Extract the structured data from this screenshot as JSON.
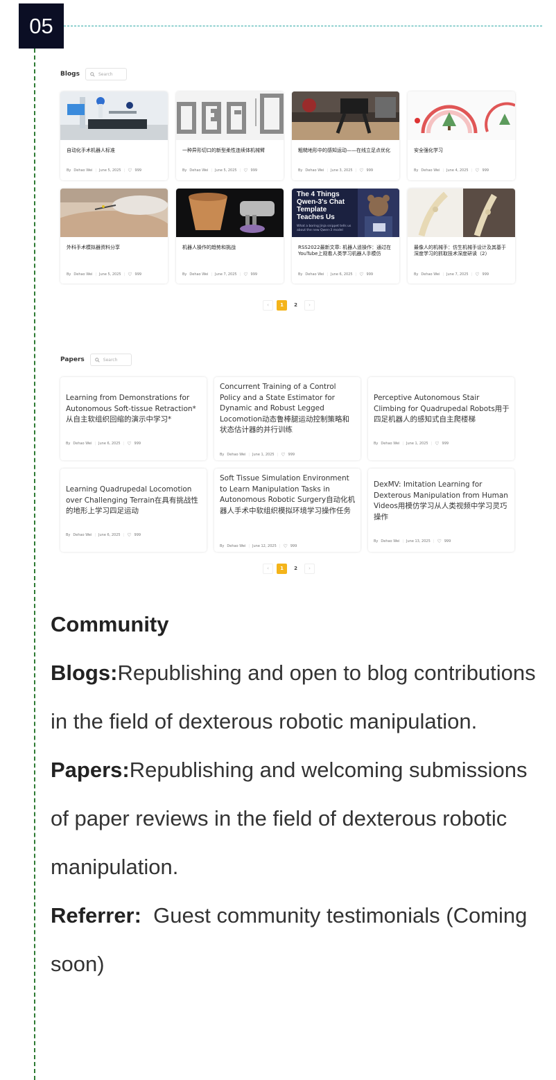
{
  "section": {
    "number": "05"
  },
  "blogs": {
    "title": "Blogs",
    "search_placeholder": "Search",
    "cards": [
      {
        "title": "自动化手术机器人标准",
        "author": "Dehao Wei",
        "date": "June 5, 2025",
        "likes": "999",
        "thumb": "surgical-robot-photo"
      },
      {
        "title": "一种异形切口的新型柔性连续体机械臂",
        "author": "Dehao Wei",
        "date": "June 5, 2025",
        "likes": "999",
        "thumb": "continuum-arm-figure"
      },
      {
        "title": "粗糙地形中的感知运动——在线立足点优化",
        "author": "Dehao Wei",
        "date": "June 3, 2025",
        "likes": "999",
        "thumb": "legged-robot-photo"
      },
      {
        "title": "安全强化学习",
        "author": "Dehao Wei",
        "date": "June 4, 2025",
        "likes": "999",
        "thumb": "safe-rl-diagram"
      },
      {
        "title": "外科手术模拟器资料分享",
        "author": "Dehao Wei",
        "date": "June 5, 2025",
        "likes": "999",
        "thumb": "surgery-simulator-photo"
      },
      {
        "title": "机器人操作的趋势和挑战",
        "author": "Dehao Wei",
        "date": "June 7, 2025",
        "likes": "999",
        "thumb": "robot-hand-pot-photo"
      },
      {
        "title": "RSS2022最新文章: 机器人遥操作：通过在YouTube上观看人类学习机器人手模仿",
        "author": "Dehao Wei",
        "date": "June 6, 2025",
        "likes": "999",
        "thumb": "qwen-banner",
        "thumb_text": {
          "headline": "The 4 Things Qwen-3's Chat Template Teaches Us",
          "sub": "What a boring Jinja snippet tells us about the new Qwen-3 model"
        }
      },
      {
        "title": "最像人的机械手：仿生机械手设计及其基于深度学习的抓取技术深度研读（2）",
        "author": "Dehao Wei",
        "date": "June 7, 2025",
        "likes": "999",
        "thumb": "bionic-hand-photo"
      }
    ],
    "pagination": {
      "prev": "‹",
      "pages": [
        "1",
        "2"
      ],
      "current": "1",
      "next": "›"
    }
  },
  "papers": {
    "title": "Papers",
    "search_placeholder": "Search",
    "cards": [
      {
        "title": "Learning from Demonstrations for Autonomous Soft-tissue Retraction* 从自主软组织回缩的演示中学习*",
        "author": "Dehao Wei",
        "date": "June 6, 2025",
        "likes": "999"
      },
      {
        "title": "Concurrent Training of a Control Policy and a State Estimator for Dynamic and Robust Legged Locomotion动态鲁棒腿运动控制策略和状态估计器的并行训练",
        "author": "Dehao Wei",
        "date": "June 1, 2025",
        "likes": "999"
      },
      {
        "title": "Perceptive Autonomous Stair Climbing for Quadrupedal Robots用于四足机器人的感知式自主爬楼梯",
        "author": "Dehao Wei",
        "date": "June 1, 2025",
        "likes": "999"
      },
      {
        "title": "Learning Quadrupedal Locomotion over Challenging Terrain在具有挑战性的地形上学习四足运动",
        "author": "Dehao Wei",
        "date": "June 6, 2025",
        "likes": "999"
      },
      {
        "title": "Soft Tissue Simulation Environment to Learn Manipulation Tasks in Autonomous Robotic Surgery自动化机器人手术中软组织模拟环境学习操作任务",
        "author": "Dehao Wei",
        "date": "June 12, 2025",
        "likes": "999"
      },
      {
        "title": "DexMV: Imitation Learning for Dexterous Manipulation from Human Videos用模仿学习从人类视频中学习灵巧操作",
        "author": "Dehao Wei",
        "date": "June 13, 2025",
        "likes": "999"
      }
    ],
    "pagination": {
      "prev": "‹",
      "pages": [
        "1",
        "2"
      ],
      "current": "1",
      "next": "›"
    }
  },
  "by_label": "By",
  "community": {
    "heading": "Community",
    "items": [
      {
        "label": "Blogs:",
        "text": "Republishing and open to blog contributions in the field of dexterous robotic manipulation."
      },
      {
        "label": "Papers:",
        "text": "Republishing and welcoming submissions of paper reviews in the field of dexterous robotic manipulation."
      },
      {
        "label": "Referrer:",
        "text": "  Guest community testimonials (Coming soon)"
      }
    ]
  },
  "colors": {
    "badge": "#0b0e24",
    "accent": "#f4b41a",
    "rule_teal": "#2aa7a3",
    "rule_green": "#2d7a33"
  }
}
